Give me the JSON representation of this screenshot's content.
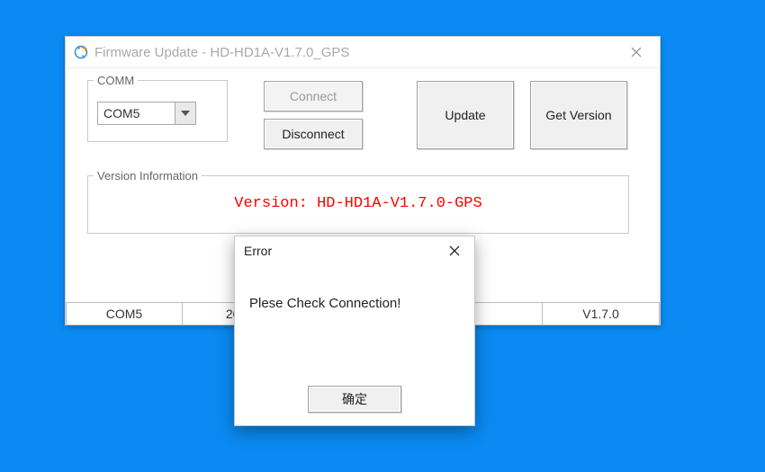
{
  "window": {
    "title": "Firmware Update - HD-HD1A-V1.7.0_GPS"
  },
  "comm": {
    "legend": "COMM",
    "selected_port": "COM5"
  },
  "buttons": {
    "connect": "Connect",
    "disconnect": "Disconnect",
    "update": "Update",
    "get_version": "Get Version"
  },
  "version_info": {
    "legend": "Version Information",
    "text": "Version: HD-HD1A-V1.7.0-GPS"
  },
  "statusbar": {
    "port": "COM5",
    "date_partial": "202",
    "middle": "",
    "version": "V1.7.0"
  },
  "error_dialog": {
    "title": "Error",
    "message": "Plese Check Connection!",
    "ok": "确定"
  }
}
